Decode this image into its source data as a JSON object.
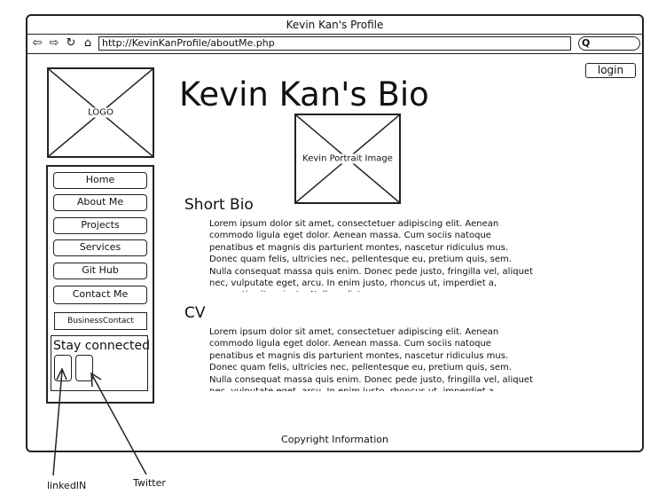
{
  "window": {
    "title": "Kevin Kan's Profile"
  },
  "toolbar": {
    "url": "http://KevinKanProfile/aboutMe.php",
    "back_icon": "back-arrow-icon",
    "forward_icon": "forward-arrow-icon",
    "reload_icon": "reload-icon",
    "home_icon": "home-icon",
    "search_icon": "search-icon"
  },
  "header": {
    "login_label": "login"
  },
  "logo": {
    "label": "LOGO"
  },
  "page": {
    "title": "Kevin Kan's Bio"
  },
  "portrait": {
    "label": "Kevin Portrait Image"
  },
  "sidebar": {
    "items": [
      {
        "label": "Home"
      },
      {
        "label": "About Me"
      },
      {
        "label": "Projects"
      },
      {
        "label": "Services"
      },
      {
        "label": "Git Hub"
      },
      {
        "label": "Contact Me"
      }
    ],
    "business_contact": "BusinessContact",
    "stay_connected": "Stay connected"
  },
  "sections": {
    "short_bio": {
      "heading": "Short Bio",
      "text": "Lorem ipsum dolor sit amet, consectetuer adipiscing elit. Aenean commodo ligula eget dolor. Aenean massa. Cum sociis natoque penatibus et magnis dis parturient montes, nascetur ridiculus mus. Donec quam felis, ultricies nec, pellentesque eu, pretium quis, sem. Nulla consequat massa quis enim. Donec pede justo, fringilla vel, aliquet nec, vulputate eget, arcu. In enim justo, rhoncus ut, imperdiet a, venenatis vitae, justo. Nullam dictum"
    },
    "cv": {
      "heading": "CV",
      "text": "Lorem ipsum dolor sit amet, consectetuer adipiscing elit. Aenean commodo ligula eget dolor. Aenean massa. Cum sociis natoque penatibus et magnis dis parturient montes, nascetur ridiculus mus. Donec quam felis, ultricies nec, pellentesque eu, pretium quis, sem. Nulla consequat massa quis enim. Donec pede justo, fringilla vel, aliquet nec, vulputate eget, arcu. In enim justo, rhoncus ut, imperdiet a, venenatis vitae, justo. Nullam dictum"
    }
  },
  "footer": {
    "text": "Copyright Information"
  },
  "annotations": {
    "linkedin": "linkedIN",
    "twitter": "Twitter"
  }
}
